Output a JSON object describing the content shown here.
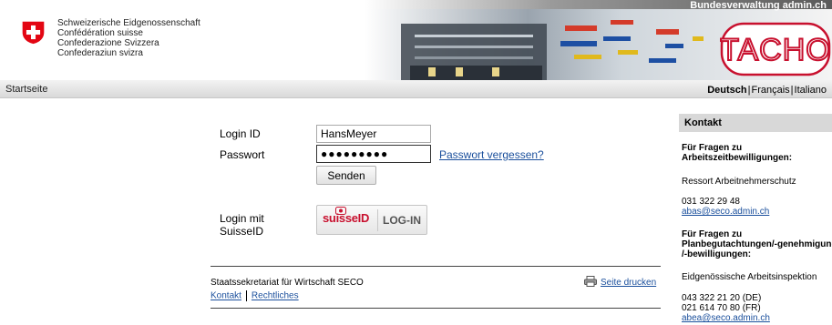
{
  "header": {
    "confederation": [
      "Schweizerische Eidgenossenschaft",
      "Confédération suisse",
      "Confederazione Svizzera",
      "Confederaziun svizra"
    ],
    "banner_title": "Bundesverwaltung admin.ch",
    "app_logo": "TACHO"
  },
  "nav": {
    "home": "Startseite",
    "languages": [
      {
        "label": "Deutsch",
        "active": true
      },
      {
        "label": "Français",
        "active": false
      },
      {
        "label": "Italiano",
        "active": false
      }
    ]
  },
  "login": {
    "id_label": "Login ID",
    "id_value": "HansMeyer",
    "pw_label": "Passwort",
    "pw_value": "●●●●●●●●●",
    "forgot": "Passwort vergessen?",
    "send": "Senden",
    "suisse_label_1": "Login mit",
    "suisse_label_2": "SuisseID",
    "suisse_logo": "suisseID",
    "suisse_btn": "LOG-IN"
  },
  "footer": {
    "org": "Staatssekretariat für Wirtschaft SECO",
    "contact": "Kontakt",
    "legal": "Rechtliches",
    "print": "Seite drucken"
  },
  "contact": {
    "title": "Kontakt",
    "q1_line1": "Für Fragen zu",
    "q1_line2": "Arbeitszeitbewilligungen:",
    "q1_org": "Ressort Arbeitnehmerschutz",
    "q1_phone": "031 322 29 48",
    "q1_email": "abas@seco.admin.ch",
    "q2_line1": "Für Fragen zu",
    "q2_line2": "Planbegutachtungen/-genehmigungen",
    "q2_line3": "/-bewilligungen:",
    "q2_org": "Eidgenössische Arbeitsinspektion",
    "q2_phone1": "043 322 21 20 (DE)",
    "q2_phone2": "021 614 70 80 (FR)",
    "q2_email": "abea@seco.admin.ch"
  },
  "colors": {
    "flag_red": "#e30613",
    "link": "#1a4f9c",
    "tacho_red": "#c8102e"
  }
}
